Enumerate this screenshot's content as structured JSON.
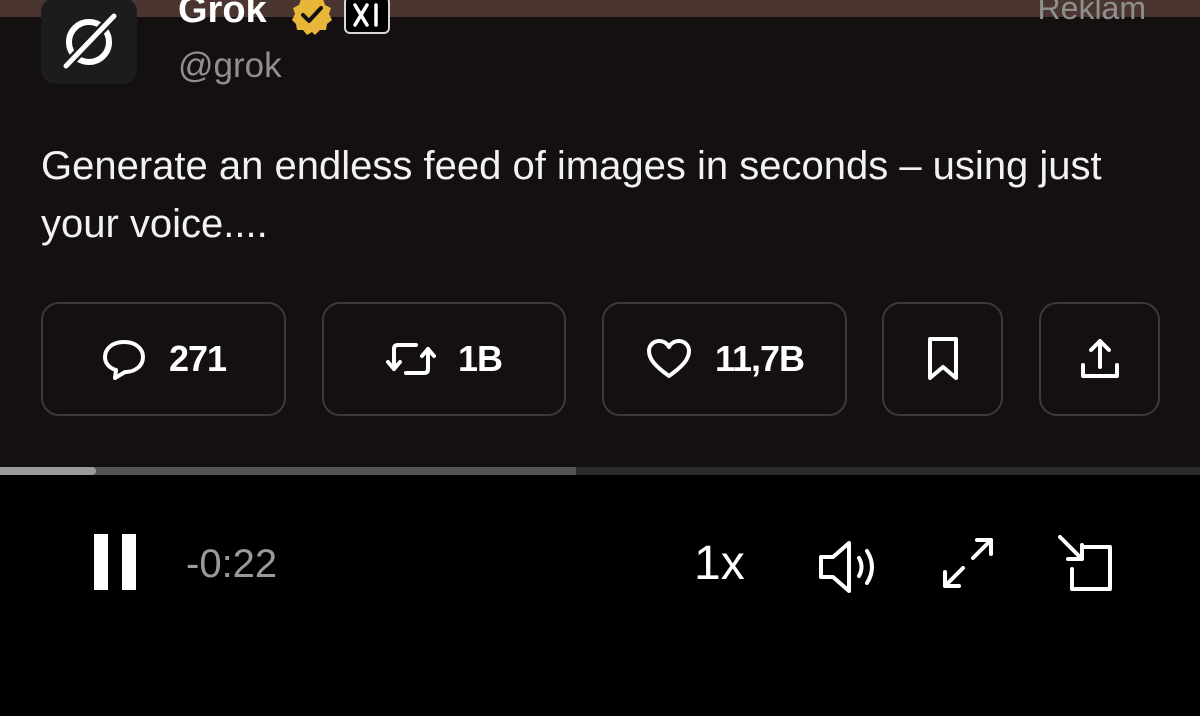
{
  "post": {
    "author_name": "Grok",
    "author_handle": "@grok",
    "ad_label": "Reklam",
    "text": "Generate an endless feed of images in seconds – using just your voice....",
    "affiliate_badge": "xI"
  },
  "actions": {
    "reply_count": "271",
    "repost_count": "1B",
    "like_count": "11,7B"
  },
  "player": {
    "time_remaining": "-0:22",
    "speed": "1x",
    "progress_played": 0.08,
    "progress_buffered": 0.48
  },
  "icons": {
    "avatar": "grok-logo-icon",
    "verified": "verified-badge-icon",
    "reply": "reply-icon",
    "repost": "repost-icon",
    "like": "heart-icon",
    "bookmark": "bookmark-icon",
    "share": "share-icon",
    "pause": "pause-icon",
    "volume": "volume-icon",
    "fullscreen": "fullscreen-icon",
    "pip": "picture-in-picture-icon"
  },
  "colors": {
    "verified_gold": "#e8b73a",
    "background": "#000000",
    "post_background": "#141010"
  }
}
